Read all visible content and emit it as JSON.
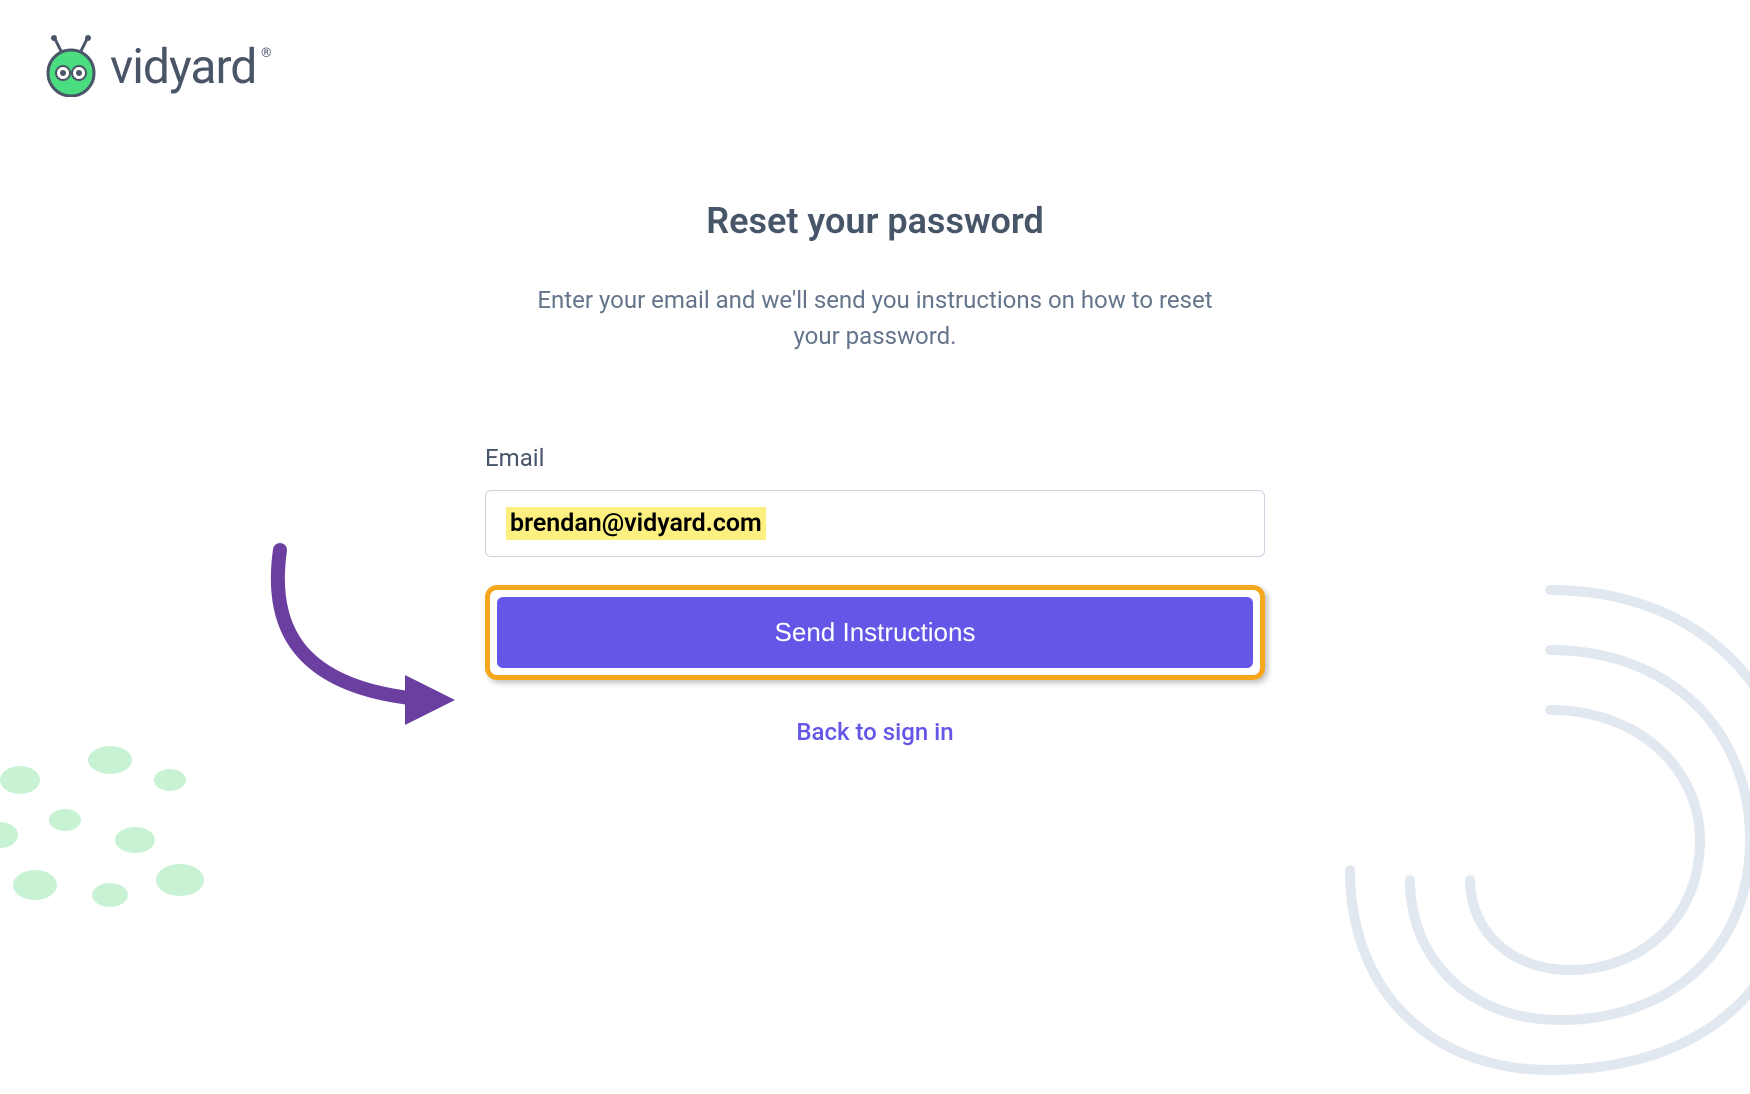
{
  "brand": {
    "name": "vidyard"
  },
  "page": {
    "title": "Reset your password",
    "subtitle": "Enter your email and we'll send you instructions on how to reset your password."
  },
  "form": {
    "email_label": "Email",
    "email_value": "brendan@vidyard.com",
    "submit_label": "Send Instructions",
    "back_link_label": "Back to sign in"
  },
  "colors": {
    "brand_green": "#4ade80",
    "brand_text": "#4a5568",
    "primary_button": "#6457e8",
    "highlight_border": "#f6a71c",
    "text_highlight": "#fcf080",
    "arrow": "#6b3fa0"
  }
}
